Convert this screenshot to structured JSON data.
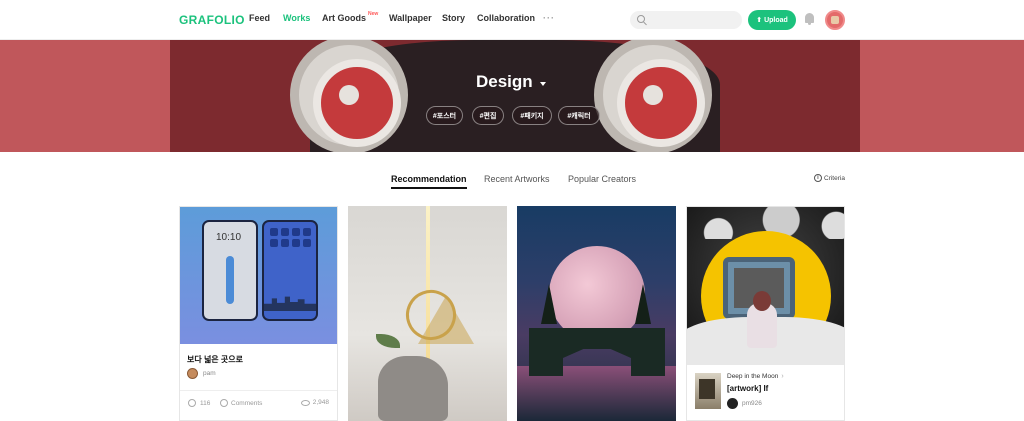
{
  "header": {
    "logo": "GRAFOLIO",
    "nav": [
      {
        "label": "Feed"
      },
      {
        "label": "Works"
      },
      {
        "label": "Art Goods",
        "badge": "New"
      },
      {
        "label": "Wallpaper"
      },
      {
        "label": "Story"
      },
      {
        "label": "Collaboration"
      },
      {
        "label": "···"
      }
    ],
    "search": {
      "placeholder": ""
    },
    "upload_label": "Upload",
    "upload_icon": "upload-arrow-icon",
    "bell_icon": "bell-icon",
    "active_nav": "Works",
    "accent_color": "#1cc27d"
  },
  "banner": {
    "title": "Design",
    "tags": [
      "#포스터",
      "#편집",
      "#패키지",
      "#캐릭터"
    ]
  },
  "tabs": {
    "items": [
      "Recommendation",
      "Recent Artworks",
      "Popular Creators"
    ],
    "active": "Recommendation",
    "criteria_label": "Criteria",
    "criteria_icon": "info-icon"
  },
  "cards": [
    {
      "phone_clock": "10:10",
      "title": "보다 넓은 곳으로",
      "author": "pam",
      "likes": "116",
      "comments_label": "Comments",
      "views": "2,948"
    },
    {},
    {},
    {
      "collection": "Deep in the Moon",
      "title": "[artwork] If",
      "author": "pm926"
    }
  ]
}
